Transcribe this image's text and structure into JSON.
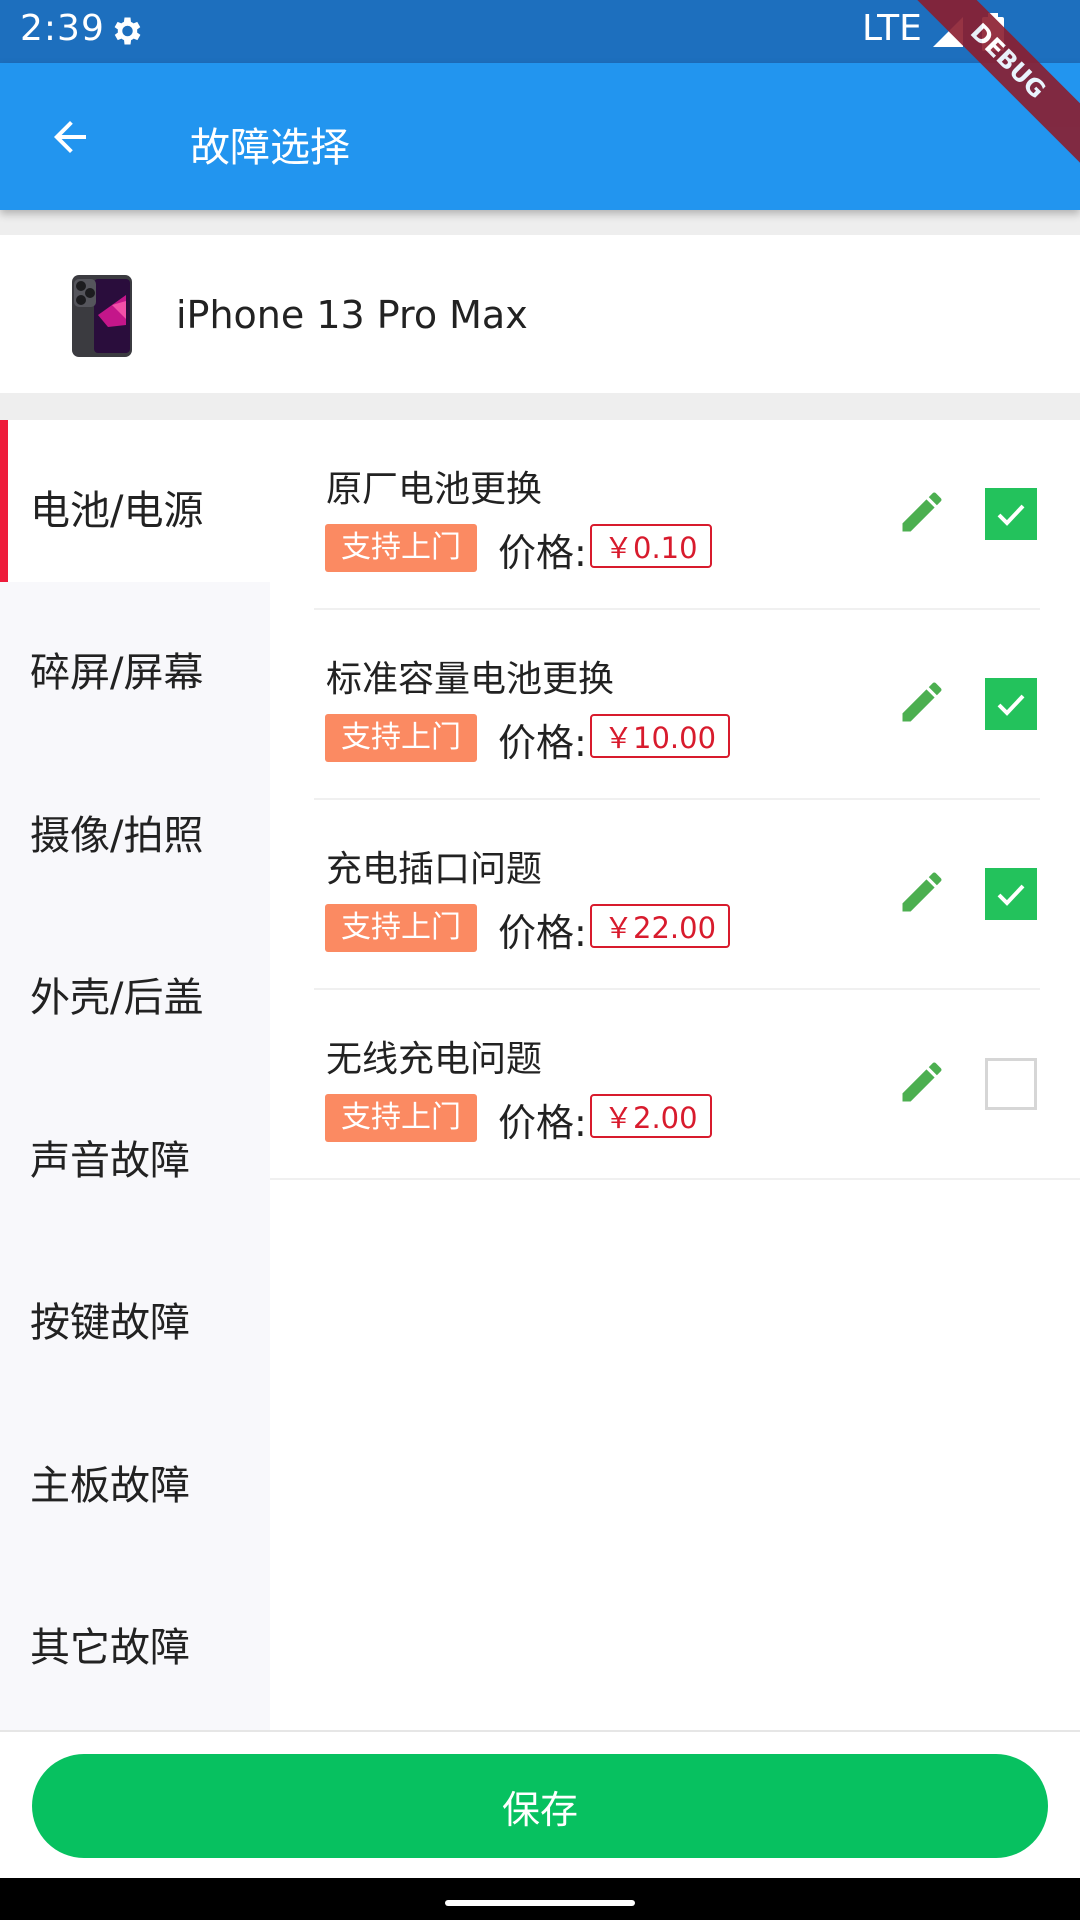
{
  "status_bar": {
    "time": "2:39",
    "network": "LTE"
  },
  "debug_banner": "DEBUG",
  "app_bar": {
    "title": "故障选择"
  },
  "device": {
    "name": "iPhone 13 Pro Max"
  },
  "sidebar": {
    "items": [
      {
        "label": "电池/电源",
        "active": true
      },
      {
        "label": "碎屏/屏幕",
        "active": false
      },
      {
        "label": "摄像/拍照",
        "active": false
      },
      {
        "label": "外壳/后盖",
        "active": false
      },
      {
        "label": "声音故障",
        "active": false
      },
      {
        "label": "按键故障",
        "active": false
      },
      {
        "label": "主板故障",
        "active": false
      },
      {
        "label": "其它故障",
        "active": false
      }
    ]
  },
  "faults": [
    {
      "name": "原厂电池更换",
      "tag": "支持上门",
      "price_label": "价格:",
      "price": "￥0.10",
      "checked": true
    },
    {
      "name": "标准容量电池更换",
      "tag": "支持上门",
      "price_label": "价格:",
      "price": "￥10.00",
      "checked": true
    },
    {
      "name": "充电插口问题",
      "tag": "支持上门",
      "price_label": "价格:",
      "price": "￥22.00",
      "checked": true
    },
    {
      "name": "无线充电问题",
      "tag": "支持上门",
      "price_label": "价格:",
      "price": "￥2.00",
      "checked": false
    }
  ],
  "save_label": "保存",
  "colors": {
    "app_bar": "#2295ef",
    "accent_red": "#ee1c3b",
    "tag_orange": "#fb8a62",
    "check_green": "#23c25c",
    "save_green": "#07c160"
  }
}
